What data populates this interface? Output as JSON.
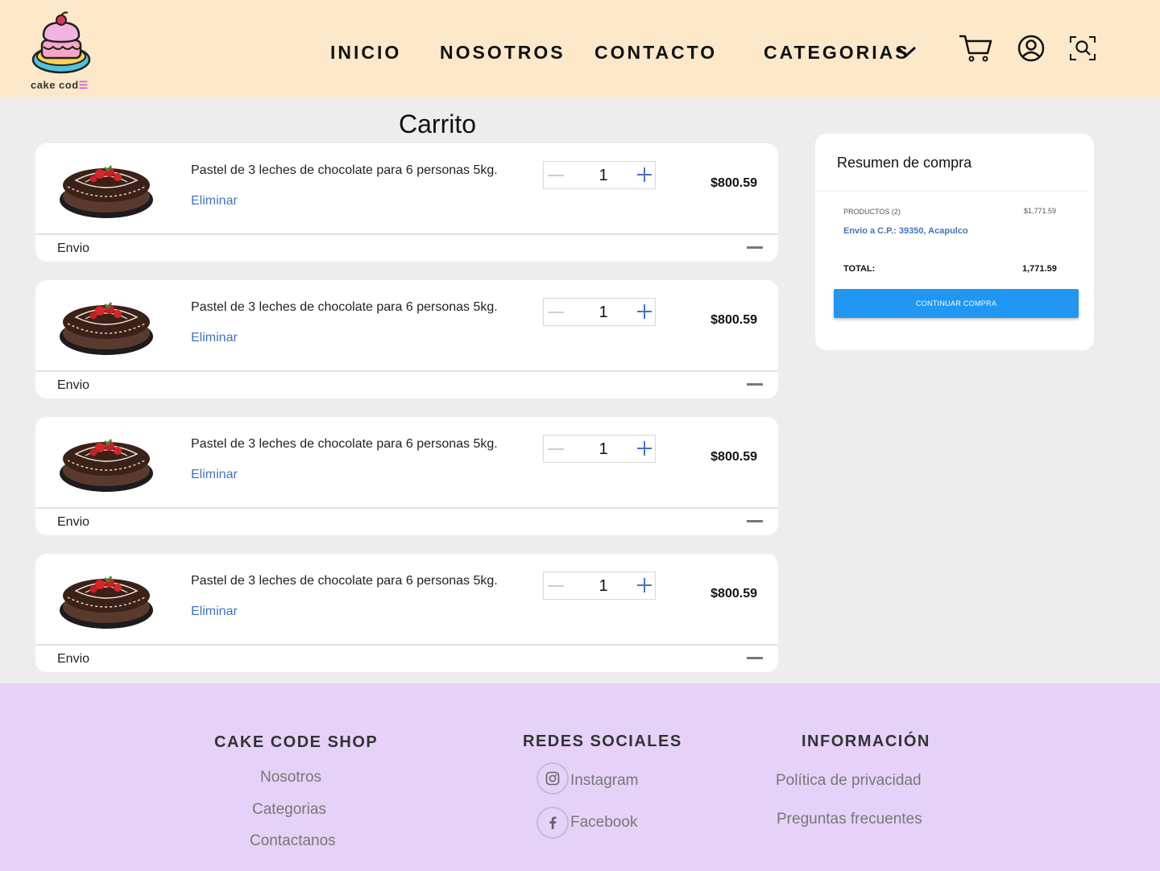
{
  "colors": {
    "header_bg": "#fde9c9",
    "page_bg": "#ededed",
    "footer_bg": "#e6d2f8",
    "link_blue": "#4472c4",
    "button_blue": "#2196f3"
  },
  "header": {
    "logo_text": "cake cod",
    "nav": [
      "INICIO",
      "NOSOTROS",
      "CONTACTO",
      "CATEGORIAS"
    ],
    "icons": [
      "chevron-down-icon",
      "cart-icon",
      "user-icon",
      "search-scan-icon"
    ]
  },
  "page": {
    "title": "Carrito"
  },
  "cart": {
    "items": [
      {
        "name": "Pastel de 3 leches de chocolate para 6 personas 5kg.",
        "remove_label": "Eliminar",
        "quantity": "1",
        "price": "$800.59",
        "shipping_label": "Envio"
      },
      {
        "name": "Pastel de 3 leches de chocolate para 6 personas 5kg.",
        "remove_label": "Eliminar",
        "quantity": "1",
        "price": "$800.59",
        "shipping_label": "Envio"
      },
      {
        "name": "Pastel de 3 leches de chocolate para 6 personas 5kg.",
        "remove_label": "Eliminar",
        "quantity": "1",
        "price": "$800.59",
        "shipping_label": "Envio"
      },
      {
        "name": "Pastel de 3 leches de chocolate para 6 personas 5kg.",
        "remove_label": "Eliminar",
        "quantity": "1",
        "price": "$800.59",
        "shipping_label": "Envio"
      }
    ]
  },
  "summary": {
    "title": "Resumen de compra",
    "products_label": "PRODUCTOS (2)",
    "products_value": "$1,771.59",
    "shipping": "Envio a C.P.: 39350, Acapulco",
    "total_label": "TOTAL:",
    "total_value": "1,771.59",
    "button_label": "CONTINUAR COMPRA"
  },
  "footer": {
    "shop": {
      "heading": "CAKE CODE SHOP",
      "links": [
        "Nosotros",
        "Categorias",
        "Contactanos"
      ]
    },
    "social": {
      "heading": "REDES SOCIALES",
      "links": [
        "Instagram",
        "Facebook"
      ]
    },
    "info": {
      "heading": "INFORMACIÓN",
      "links": [
        "Política de privacidad",
        "Preguntas frecuentes"
      ]
    }
  }
}
